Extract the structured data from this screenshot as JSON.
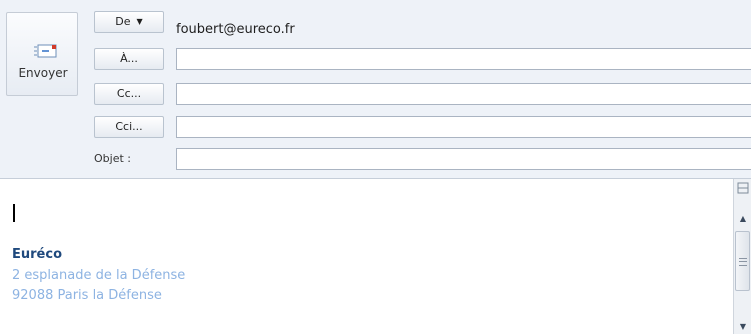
{
  "compose": {
    "send_label": "Envoyer",
    "from_label": "De",
    "from_value": "foubert@eureco.fr",
    "to_label": "À...",
    "cc_label": "Cc...",
    "bcc_label": "Cci...",
    "subject_label": "Objet :",
    "to_value": "",
    "cc_value": "",
    "bcc_value": "",
    "subject_value": ""
  },
  "signature": {
    "company": "Euréco",
    "address_line1": "2 esplanade de la Défense",
    "address_line2": "92088 Paris la Défense"
  },
  "scrollbar": {
    "corner_icon": "split-icon",
    "up_icon": "arrow-up-icon",
    "down_icon": "arrow-down-icon"
  },
  "colors": {
    "header_bg": "#eef2f8",
    "company": "#1f497d",
    "address": "#8db3e2"
  }
}
